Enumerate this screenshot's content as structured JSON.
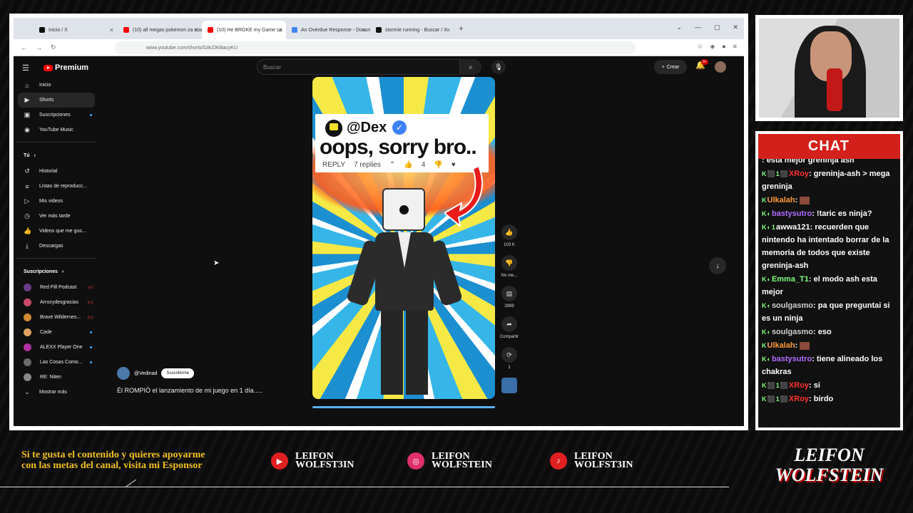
{
  "browser": {
    "tabs": [
      {
        "label": "Inicio / X",
        "color": "#111111"
      },
      {
        "label": "(10) all megas pokemon za star",
        "color": "#ff0000"
      },
      {
        "label": "(10) He BROKE my Game La",
        "color": "#ff0000",
        "active": true
      },
      {
        "label": "An Overdue Response - Docum",
        "color": "#4285f4"
      },
      {
        "label": "stormie running - Buscar / X",
        "color": "#111111"
      }
    ],
    "url": "www.youtube.com/shorts/G8cOKBacyKU"
  },
  "youtube": {
    "logo_text": "Premium",
    "search_placeholder": "Buscar",
    "create_label": "Crear",
    "notif_badge": "9+",
    "sidebar_main": [
      {
        "label": "Inicio",
        "icon": "home-icon",
        "glyph": "⌂"
      },
      {
        "label": "Shorts",
        "icon": "shorts-icon",
        "glyph": "▶",
        "active": true
      },
      {
        "label": "Suscripciones",
        "icon": "subscriptions-icon",
        "glyph": "▣",
        "dot": true
      },
      {
        "label": "YouTube Music",
        "icon": "music-icon",
        "glyph": "◉"
      }
    ],
    "you_heading": "Tú",
    "sidebar_you": [
      {
        "label": "Historial",
        "icon": "history-icon",
        "glyph": "↺"
      },
      {
        "label": "Listas de reproducc...",
        "icon": "playlist-icon",
        "glyph": "≡"
      },
      {
        "label": "Mis videos",
        "icon": "my-videos-icon",
        "glyph": "▷"
      },
      {
        "label": "Ver más tarde",
        "icon": "watch-later-icon",
        "glyph": "◷"
      },
      {
        "label": "Videos que me gus...",
        "icon": "liked-icon",
        "glyph": "👍"
      },
      {
        "label": "Descargas",
        "icon": "download-icon",
        "glyph": "⤓"
      }
    ],
    "subs_heading": "Suscripciones",
    "subscriptions": [
      {
        "label": "Red Pill Podcast",
        "color": "#6a3a8a",
        "live": true
      },
      {
        "label": "Arrozydesgracias",
        "color": "#c84a6a",
        "live": true
      },
      {
        "label": "Brave Wildernes...",
        "color": "#d08a30",
        "live": true
      },
      {
        "label": "Cade",
        "color": "#e0a060",
        "dot": true
      },
      {
        "label": "ALEXX Player One",
        "color": "#b030a0",
        "dot": true
      },
      {
        "label": "Las Cosas Como...",
        "color": "#6a6a6a",
        "dot": true
      },
      {
        "label": "RE: Niten",
        "color": "#888888"
      }
    ],
    "show_more": "Mostrar más",
    "short": {
      "comment_user": "@Dex",
      "comment_text": "oops, sorry bro..",
      "reply_label": "REPLY",
      "replies": "7 replies",
      "likes": "4",
      "channel": "@Vedinad",
      "subscribe": "Suscribirme",
      "title": "Él ROMPIÓ el lanzamiento de mi juego en 1 día....."
    },
    "actions": [
      {
        "label": "103 K",
        "icon": "like-icon",
        "glyph": "👍"
      },
      {
        "label": "No me...",
        "icon": "dislike-icon",
        "glyph": "👎"
      },
      {
        "label": "3999",
        "icon": "comment-icon",
        "glyph": "▤"
      },
      {
        "label": "Compartir",
        "icon": "share-icon",
        "glyph": "➦"
      },
      {
        "label": "1",
        "icon": "remix-icon",
        "glyph": "⟳"
      }
    ]
  },
  "chat": {
    "title": "CHAT",
    "messages": [
      {
        "user": "",
        "color": "#ff4040",
        "text": ": está mejor greninja ash",
        "badges": "",
        "partial": true
      },
      {
        "user": "XRoy",
        "color": "#ff3030",
        "text": ": greninja-ash > mega greninja",
        "badges": "K⬛1⬛"
      },
      {
        "user": "Ulkalah",
        "color": "#ff9a3a",
        "text": ": ",
        "badges": "K",
        "emote": true
      },
      {
        "user": "bastysutro",
        "color": "#b36bff",
        "text": ": !taric es ninja?",
        "badges": "K◐"
      },
      {
        "user": "awwa121",
        "color": "#ffffff",
        "text": ": recuerden que nintendo ha intentado borrar de la memoria de todos que existe greninja-ash",
        "badges": "K◐1"
      },
      {
        "user": "Emma_T1",
        "color": "#7cfc7c",
        "text": ": el modo ash esta mejor",
        "badges": "K◐"
      },
      {
        "user": "soulgasmo",
        "color": "#cfcfcf",
        "text": ": pa que preguntai si es un ninja",
        "badges": "K◐"
      },
      {
        "user": "soulgasmo",
        "color": "#cfcfcf",
        "text": ": eso",
        "badges": "K◐"
      },
      {
        "user": "Ulkalah",
        "color": "#ff9a3a",
        "text": ": ",
        "badges": "K",
        "emote": true
      },
      {
        "user": "bastysutro",
        "color": "#b36bff",
        "text": ": tiene alineado los chakras",
        "badges": "K◐"
      },
      {
        "user": "XRoy",
        "color": "#ff3030",
        "text": ": si",
        "badges": "K⬛1⬛"
      },
      {
        "user": "XRoy",
        "color": "#ff3030",
        "text": ": birdo",
        "badges": "K⬛1⬛"
      }
    ]
  },
  "overlay": {
    "sponsor_text": "Si te gusta el contenido y quieres apoyarme con las metas del canal, visita mi Esponsor",
    "socials": [
      {
        "line1": "LEIFON",
        "line2": "WOLFST3IN",
        "icon": "youtube-icon",
        "color": "#e02020",
        "glyph": "▶"
      },
      {
        "line1": "LEIFON",
        "line2": "WOLFSTEIN",
        "icon": "instagram-icon",
        "color": "#e0306a",
        "glyph": "◎"
      },
      {
        "line1": "LEIFON",
        "line2": "WOLFST3IN",
        "icon": "tiktok-icon",
        "color": "#e02020",
        "glyph": "♪"
      }
    ],
    "logo_line1": "LEIFON",
    "logo_line2": "WOLFSTEIN"
  }
}
